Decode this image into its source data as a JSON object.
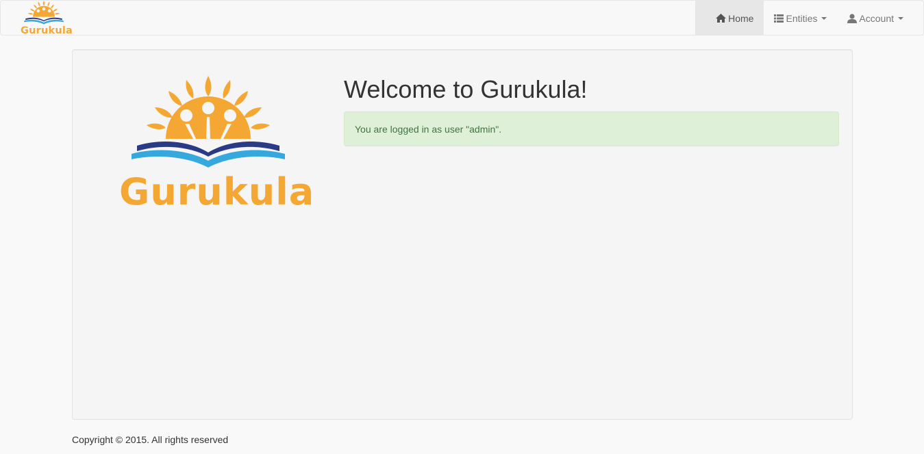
{
  "brand": {
    "name": "Gurukula",
    "logo_icon": "gurukula-logo-icon",
    "color": "#f5a733"
  },
  "nav": {
    "home": {
      "label": "Home",
      "icon": "home-icon"
    },
    "entities": {
      "label": "Entities",
      "icon": "list-icon"
    },
    "account": {
      "label": "Account",
      "icon": "user-icon"
    }
  },
  "main": {
    "logo_text": "Gurukula",
    "title": "Welcome to Gurukula!",
    "alert": "You are logged in as user \"admin\"."
  },
  "footer": {
    "copyright": "Copyright © 2015. All rights reserved"
  },
  "colors": {
    "sun": "#f5a733",
    "book_dark": "#2a3a84",
    "book_light": "#35a9de",
    "alert_bg": "#dff0d8",
    "alert_text": "#3c763d"
  }
}
